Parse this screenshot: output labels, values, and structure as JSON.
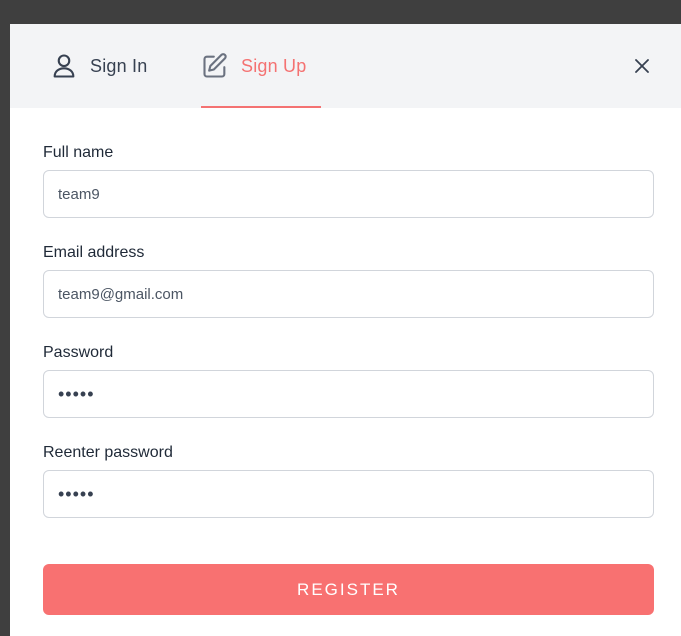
{
  "tabs": {
    "sign_in": {
      "label": "Sign In",
      "icon": "user-icon"
    },
    "sign_up": {
      "label": "Sign Up",
      "icon": "edit-icon",
      "active": true
    }
  },
  "close": {
    "icon": "close-icon"
  },
  "form": {
    "full_name": {
      "label": "Full name",
      "value": "team9"
    },
    "email": {
      "label": "Email address",
      "value": "team9@gmail.com"
    },
    "password": {
      "label": "Password",
      "value": "•••••"
    },
    "reenter_password": {
      "label": "Reenter password",
      "value": "•••••"
    }
  },
  "register": {
    "label": "REGISTER"
  },
  "colors": {
    "accent": "#f87171",
    "header_bg": "#f3f4f6",
    "backdrop": "#3f3f3f"
  }
}
